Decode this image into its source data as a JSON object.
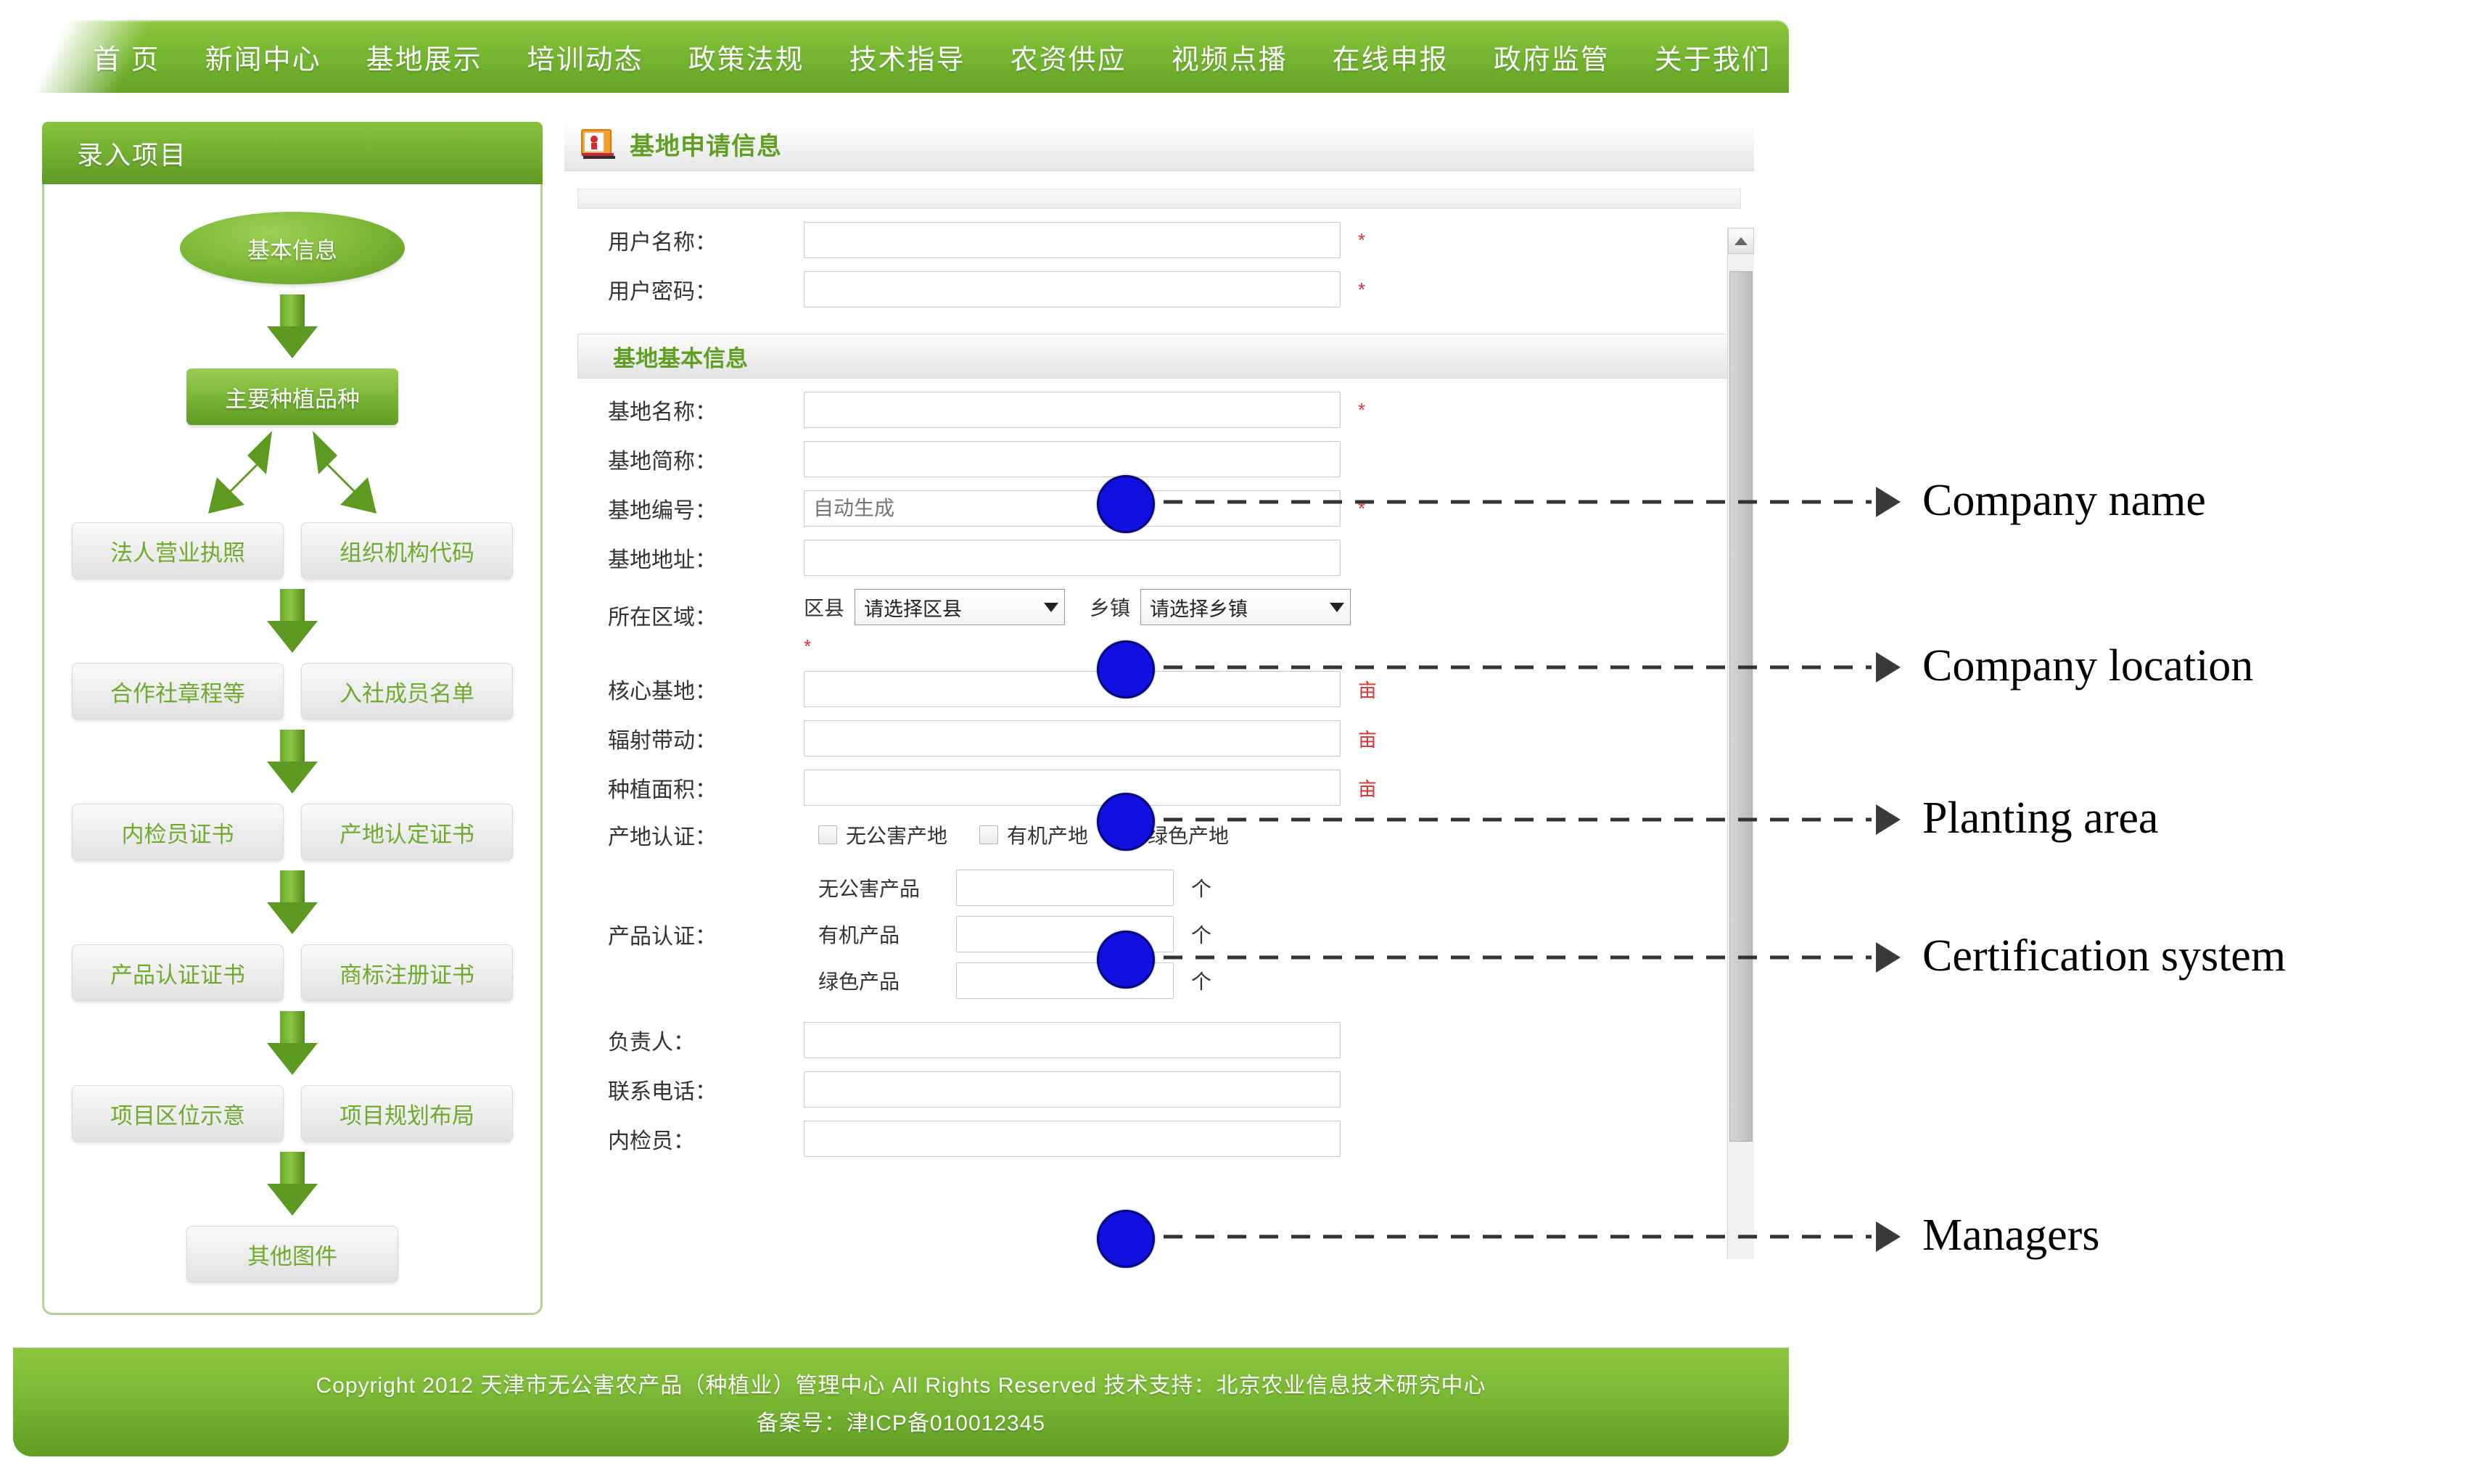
{
  "nav": {
    "items": [
      {
        "label": "首 页"
      },
      {
        "label": "新闻中心"
      },
      {
        "label": "基地展示"
      },
      {
        "label": "培训动态"
      },
      {
        "label": "政策法规"
      },
      {
        "label": "技术指导"
      },
      {
        "label": "农资供应"
      },
      {
        "label": "视频点播"
      },
      {
        "label": "在线申报"
      },
      {
        "label": "政府监管"
      },
      {
        "label": "关于我们"
      }
    ]
  },
  "sidebar": {
    "header": "录入项目",
    "flow": {
      "start": "基本信息",
      "second": "主要种植品种",
      "pair1": [
        "法人营业执照",
        "组织机构代码"
      ],
      "pair2": [
        "合作社章程等",
        "入社成员名单"
      ],
      "pair3": [
        "内检员证书",
        "产地认定证书"
      ],
      "pair4": [
        "产品认证证书",
        "商标注册证书"
      ],
      "pair5": [
        "项目区位示意",
        "项目规划布局"
      ],
      "end": "其他图件"
    }
  },
  "content": {
    "title": "基地申请信息",
    "icon": "book-icon",
    "account": {
      "username_label": "用户名称：",
      "username_value": "",
      "password_label": "用户密码：",
      "password_value": "",
      "required_mark": "*"
    },
    "section_basic": "基地基本信息",
    "fields": {
      "base_name_label": "基地名称：",
      "base_name_value": "",
      "base_short_label": "基地简称：",
      "base_short_value": "",
      "base_code_label": "基地编号：",
      "base_code_placeholder": "自动生成",
      "base_addr_label": "基地地址：",
      "base_addr_value": "",
      "region_label": "所在区域：",
      "district_label": "区县",
      "district_value": "请选择区县",
      "township_label": "乡镇",
      "township_value": "请选择乡镇",
      "core_base_label": "核心基地：",
      "core_base_value": "",
      "radiate_label": "辐射带动：",
      "radiate_value": "",
      "planting_area_label": "种植面积：",
      "planting_area_value": "",
      "area_unit": "亩",
      "origin_cert_label": "产地认证：",
      "origin_cert_options": [
        "无公害产地",
        "有机产地",
        "绿色产地"
      ],
      "product_cert_label": "产品认证：",
      "product_cert_rows": [
        {
          "name": "无公害产品",
          "value": "",
          "unit": "个"
        },
        {
          "name": "有机产品",
          "value": "",
          "unit": "个"
        },
        {
          "name": "绿色产品",
          "value": "",
          "unit": "个"
        }
      ],
      "manager_label": "负责人：",
      "manager_value": "",
      "phone_label": "联系电话：",
      "phone_value": "",
      "inspector_label": "内检员：",
      "inspector_value": ""
    }
  },
  "footer": {
    "line1": "Copyright 2012 天津市无公害农产品（种植业）管理中心 All Rights Reserved 技术支持：北京农业信息技术研究中心",
    "line2": "备案号：津ICP备010012345"
  },
  "annotations": [
    {
      "label": "Company name"
    },
    {
      "label": "Company location"
    },
    {
      "label": "Planting area"
    },
    {
      "label": "Certification system"
    },
    {
      "label": "Managers"
    }
  ]
}
